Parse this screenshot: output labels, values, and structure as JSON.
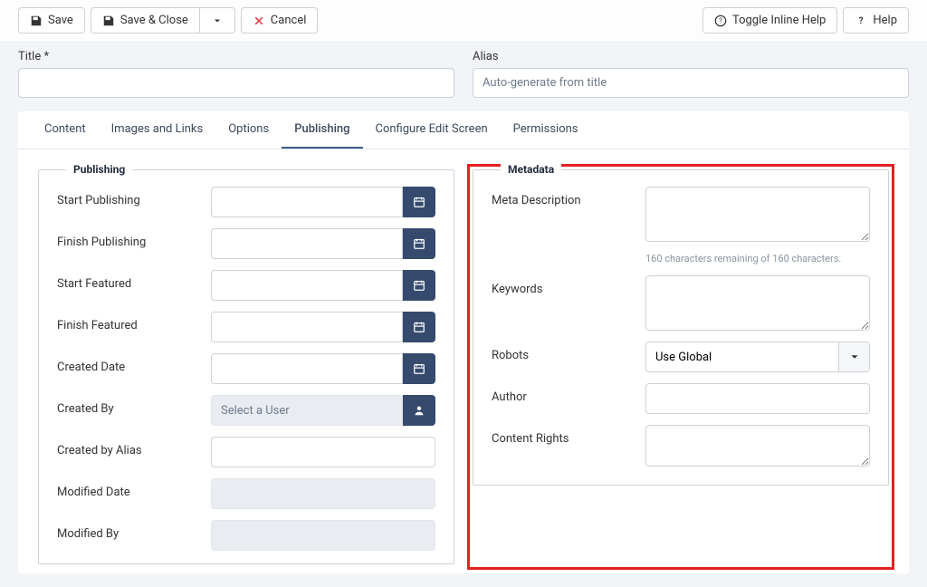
{
  "toolbar": {
    "save": "Save",
    "save_close": "Save & Close",
    "cancel": "Cancel",
    "toggle_help": "Toggle Inline Help",
    "help": "Help"
  },
  "title": {
    "label": "Title *",
    "value": ""
  },
  "alias": {
    "label": "Alias",
    "placeholder": "Auto-generate from title",
    "value": ""
  },
  "tabs": [
    "Content",
    "Images and Links",
    "Options",
    "Publishing",
    "Configure Edit Screen",
    "Permissions"
  ],
  "active_tab": 3,
  "publishing": {
    "legend": "Publishing",
    "start_publishing": "Start Publishing",
    "finish_publishing": "Finish Publishing",
    "start_featured": "Start Featured",
    "finish_featured": "Finish Featured",
    "created_date": "Created Date",
    "created_by": "Created By",
    "created_by_placeholder": "Select a User",
    "created_by_alias": "Created by Alias",
    "modified_date": "Modified Date",
    "modified_by": "Modified By"
  },
  "metadata": {
    "legend": "Metadata",
    "meta_description": "Meta Description",
    "meta_hint": "160 characters remaining of 160 characters.",
    "keywords": "Keywords",
    "robots": "Robots",
    "robots_value": "Use Global",
    "author": "Author",
    "content_rights": "Content Rights"
  }
}
